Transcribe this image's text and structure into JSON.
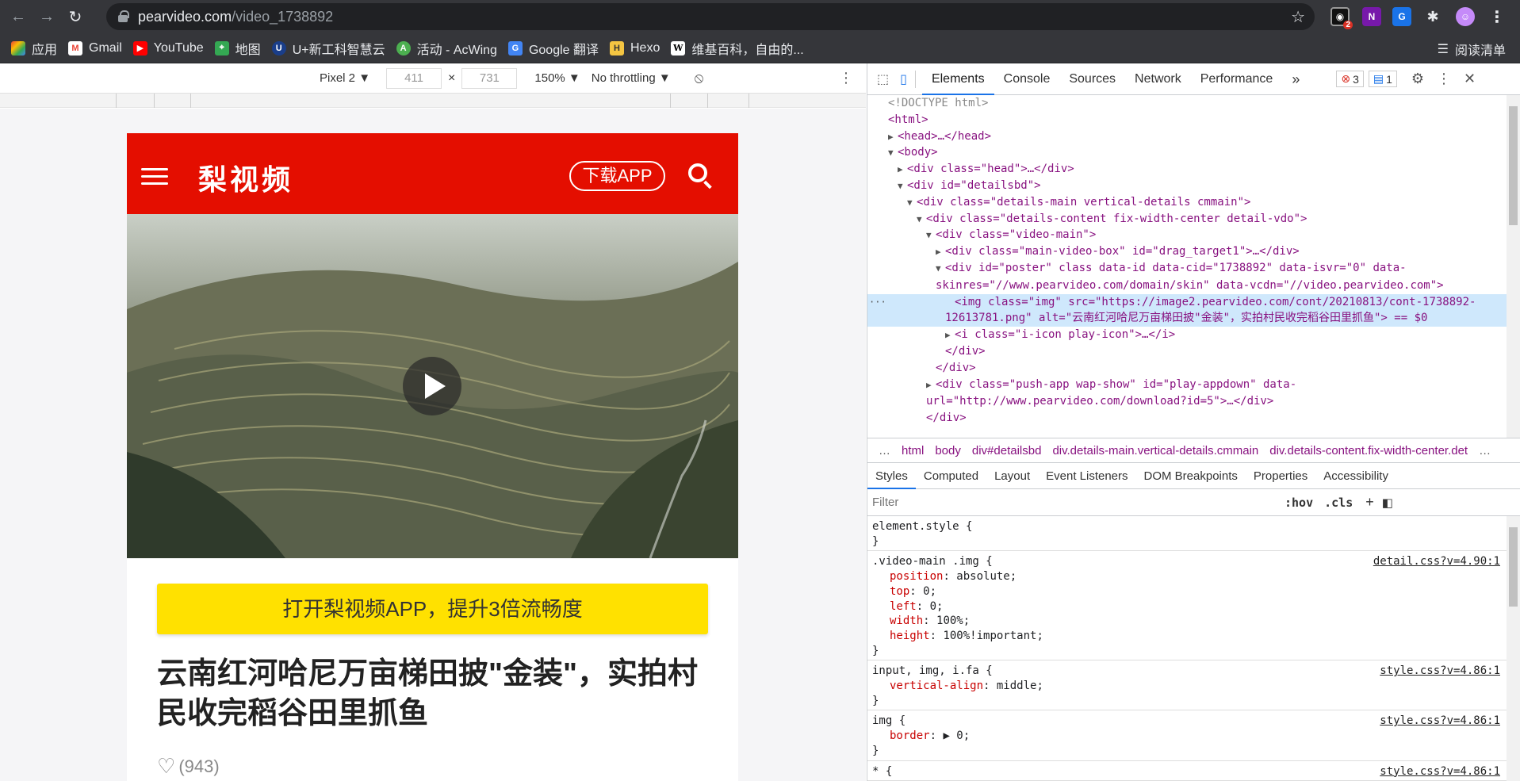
{
  "browser": {
    "url_host": "pearvideo.com",
    "url_path": "/video_1738892",
    "ext_badge": "2",
    "bookmarks": [
      {
        "label": "应用",
        "icon": "apps-grid-icon"
      },
      {
        "label": "Gmail",
        "icon": "gmail-icon"
      },
      {
        "label": "YouTube",
        "icon": "youtube-icon"
      },
      {
        "label": "地图",
        "icon": "maps-icon"
      },
      {
        "label": "U+新工科智慧云",
        "icon": "uplus-icon"
      },
      {
        "label": "活动 - AcWing",
        "icon": "acwing-icon"
      },
      {
        "label": "Google 翻译",
        "icon": "google-translate-icon"
      },
      {
        "label": "Hexo",
        "icon": "hexo-icon"
      },
      {
        "label": "维基百科，自由的...",
        "icon": "wikipedia-icon"
      }
    ],
    "reading_list": "阅读清单"
  },
  "device_toolbar": {
    "device": "Pixel 2 ▼",
    "width": "411",
    "times": "×",
    "height": "731",
    "zoom": "150% ▼",
    "throttle": "No throttling ▼"
  },
  "page": {
    "logo": "梨视频",
    "download_btn": "下载APP",
    "app_banner": "打开梨视频APP，提升3倍流畅度",
    "title": "云南红河哈尼万亩梯田披\"金装\"，实拍村民收完稻谷田里抓鱼",
    "likes": "(943)"
  },
  "devtools": {
    "tabs": [
      "Elements",
      "Console",
      "Sources",
      "Network",
      "Performance"
    ],
    "more": "»",
    "errors": "3",
    "messages": "1",
    "dom_lines": [
      {
        "indent": 0,
        "tri": "",
        "html": "<!DOCTYPE html>"
      },
      {
        "indent": 0,
        "tri": "",
        "html": "<html>"
      },
      {
        "indent": 1,
        "tri": "▶",
        "html": "<head>…</head>"
      },
      {
        "indent": 1,
        "tri": "▼",
        "html": "<body>"
      },
      {
        "indent": 2,
        "tri": "▶",
        "html": "<div class=\"head\">…</div>"
      },
      {
        "indent": 2,
        "tri": "▼",
        "html": "<div id=\"detailsbd\">"
      },
      {
        "indent": 3,
        "tri": "▼",
        "html": "<div class=\"details-main vertical-details cmmain\">"
      },
      {
        "indent": 4,
        "tri": "▼",
        "html": "<div class=\"details-content fix-width-center detail-vdo\">"
      },
      {
        "indent": 5,
        "tri": "▼",
        "html": "<div class=\"video-main\">"
      },
      {
        "indent": 6,
        "tri": "▶",
        "html": "<div class=\"main-video-box\" id=\"drag_target1\">…</div>"
      },
      {
        "indent": 6,
        "tri": "▼",
        "html": "<div id=\"poster\" class data-id data-cid=\"1738892\" data-isvr=\"0\" data-skinres=\"//www.pearvideo.com/domain/skin\" data-vcdn=\"//video.pearvideo.com\">",
        "wrap": true
      },
      {
        "indent": 7,
        "tri": "",
        "html": "<img class=\"img\" src=\"https://image2.pearvideo.com/cont/20210813/cont-1738892-12613781.png\" alt=\"云南红河哈尼万亩梯田披\"金装\"，实拍村民收完稻谷田里抓鱼\"> == $0",
        "wrap": true,
        "highlight": true
      },
      {
        "indent": 7,
        "tri": "▶",
        "html": "<i class=\"i-icon play-icon\">…</i>"
      },
      {
        "indent": 6,
        "tri": "",
        "html": "</div>"
      },
      {
        "indent": 5,
        "tri": "",
        "html": "</div>"
      },
      {
        "indent": 5,
        "tri": "▶",
        "html": "<div class=\"push-app wap-show\" id=\"play-appdown\" data-url=\"http://www.pearvideo.com/download?id=5\">…</div>",
        "wrap": true
      },
      {
        "indent": 4,
        "tri": "",
        "html": "</div>"
      }
    ],
    "breadcrumbs": [
      "…",
      "html",
      "body",
      "div#detailsbd",
      "div.details-main.vertical-details.cmmain",
      "div.details-content.fix-width-center.det",
      "…"
    ],
    "subtabs": [
      "Styles",
      "Computed",
      "Layout",
      "Event Listeners",
      "DOM Breakpoints",
      "Properties",
      "Accessibility"
    ],
    "filter_placeholder": "Filter",
    "hov": ":hov",
    "cls": ".cls",
    "rules": [
      {
        "selector": "element.style {",
        "source": "",
        "props": [],
        "close": "}"
      },
      {
        "selector": ".video-main .img {",
        "source": "detail.css?v=4.90:1",
        "props": [
          [
            "position",
            "absolute;"
          ],
          [
            "top",
            "0;"
          ],
          [
            "left",
            "0;"
          ],
          [
            "width",
            "100%;"
          ],
          [
            "height",
            "100%!important;"
          ]
        ],
        "close": "}"
      },
      {
        "selector": "input, img, i.fa {",
        "source": "style.css?v=4.86:1",
        "props": [
          [
            "vertical-align",
            "middle;"
          ]
        ],
        "close": "}"
      },
      {
        "selector": "img {",
        "source": "style.css?v=4.86:1",
        "props": [
          [
            "border",
            "▶ 0;"
          ]
        ],
        "close": "}"
      },
      {
        "selector": "* {",
        "source": "style.css?v=4.86:1",
        "props": [],
        "close": ""
      }
    ]
  }
}
